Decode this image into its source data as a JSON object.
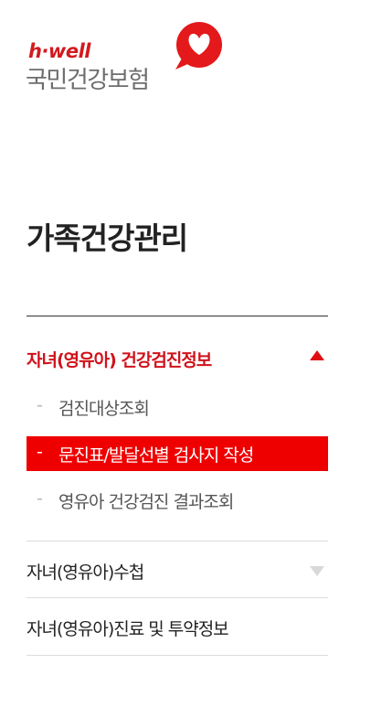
{
  "logo": {
    "brand": "h·well",
    "name": "국민건강보험",
    "mark_color": "#e3191b"
  },
  "page_title": "가족건강관리",
  "menu": {
    "section_open": {
      "label": "자녀(영유아) 건강검진정보",
      "expanded": true,
      "items": [
        {
          "label": "검진대상조회",
          "active": false
        },
        {
          "label": "문진표/발달선별 검사지 작성",
          "active": true
        },
        {
          "label": "영유아 건강검진 결과조회",
          "active": false
        }
      ]
    },
    "section_2": {
      "label": "자녀(영유아)수첩",
      "expanded": false
    },
    "section_3": {
      "label": "자녀(영유아)진료 및 투약정보"
    }
  },
  "colors": {
    "accent": "#d0121b",
    "active_bg": "#ef0000"
  }
}
